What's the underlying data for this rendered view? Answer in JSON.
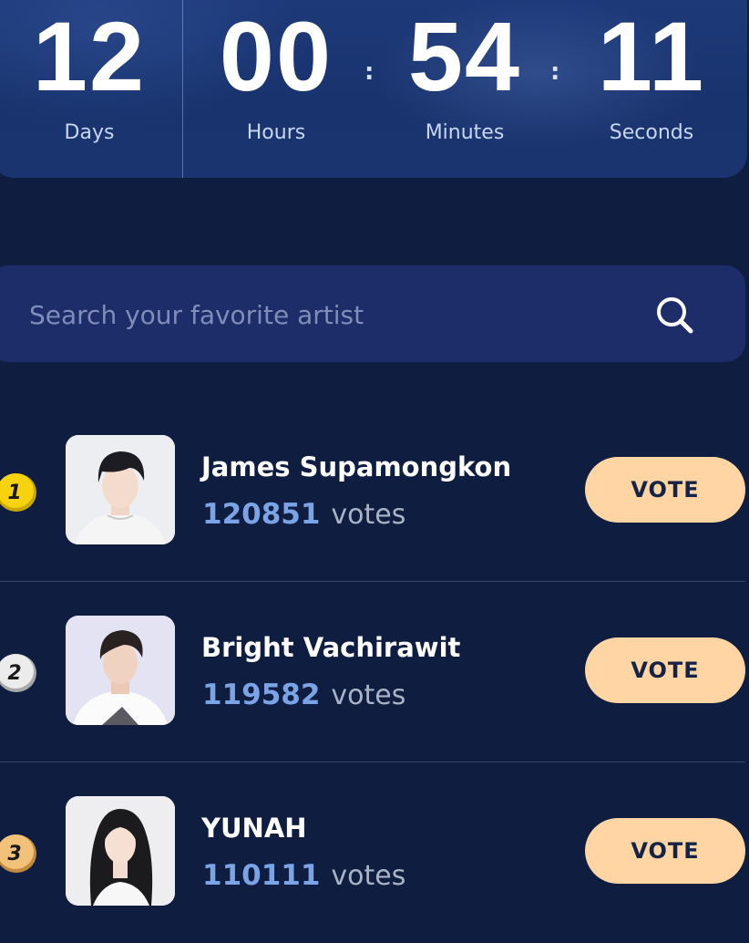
{
  "countdown": {
    "days": {
      "value": "12",
      "label": "Days"
    },
    "hours": {
      "value": "00",
      "label": "Hours"
    },
    "minutes": {
      "value": "54",
      "label": "Minutes"
    },
    "seconds": {
      "value": "11",
      "label": "Seconds"
    },
    "separator": ":"
  },
  "search": {
    "placeholder": "Search your favorite artist",
    "icon": "search-icon"
  },
  "ranking": [
    {
      "rank": "1",
      "name": "James Supamongkon",
      "votes": "120851",
      "votes_word": "votes",
      "button": "VOTE",
      "medal_color": "#f6d20f"
    },
    {
      "rank": "2",
      "name": "Bright Vachirawit",
      "votes": "119582",
      "votes_word": "votes",
      "button": "VOTE",
      "medal_color": "#e8e8e8"
    },
    {
      "rank": "3",
      "name": "YUNAH",
      "votes": "110111",
      "votes_word": "votes",
      "button": "VOTE",
      "medal_color": "#f2c27a"
    }
  ],
  "colors": {
    "background": "#0e1d40",
    "panel": "#1c2d6a",
    "vote_count": "#7ba4e6",
    "vote_button": "#ffd6a3"
  }
}
